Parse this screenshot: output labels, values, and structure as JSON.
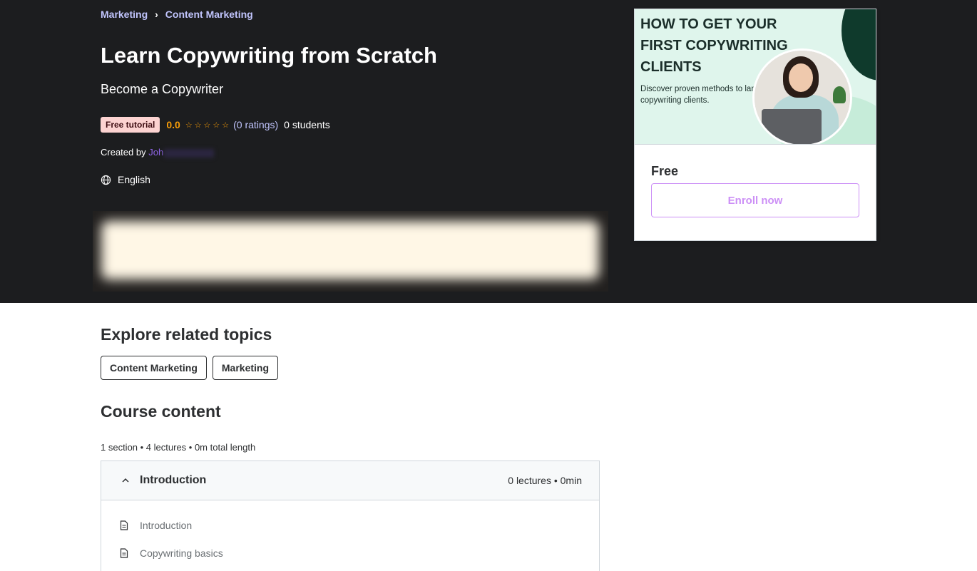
{
  "breadcrumb": {
    "items": [
      "Marketing",
      "Content Marketing"
    ],
    "separator": "›"
  },
  "course": {
    "title": "Learn Copywriting from Scratch",
    "subtitle": "Become a Copywriter",
    "badge": "Free tutorial",
    "rating_value": "0.0",
    "stars": "☆☆☆☆☆",
    "ratings_count": "(0 ratings)",
    "students": "0 students",
    "created_by_label": "Created by",
    "author_visible": "Joh",
    "language": "English"
  },
  "card": {
    "preview": {
      "headline": "HOW TO GET YOUR FIRST COPYWRITING CLIENTS",
      "description": "Discover proven methods to land copywriting clients."
    },
    "price": "Free",
    "enroll_label": "Enroll now"
  },
  "related": {
    "title": "Explore related topics",
    "topics": [
      "Content Marketing",
      "Marketing"
    ]
  },
  "content": {
    "title": "Course content",
    "summary": "1 section • 4 lectures • 0m total length",
    "section": {
      "title": "Introduction",
      "meta": "0 lectures • 0min",
      "lectures": [
        "Introduction",
        "Copywriting basics"
      ]
    }
  },
  "colors": {
    "hero_bg": "#1c1d1f",
    "accent_purple": "#a435f0",
    "link_lavender": "#c0c4fc",
    "star_orange": "#f69c08",
    "badge_bg": "#fcd3d1"
  },
  "icons": {
    "breadcrumb_sep": "chevron-right-icon",
    "language": "globe-icon",
    "section_toggle": "chevron-up-icon",
    "lecture": "document-icon"
  }
}
